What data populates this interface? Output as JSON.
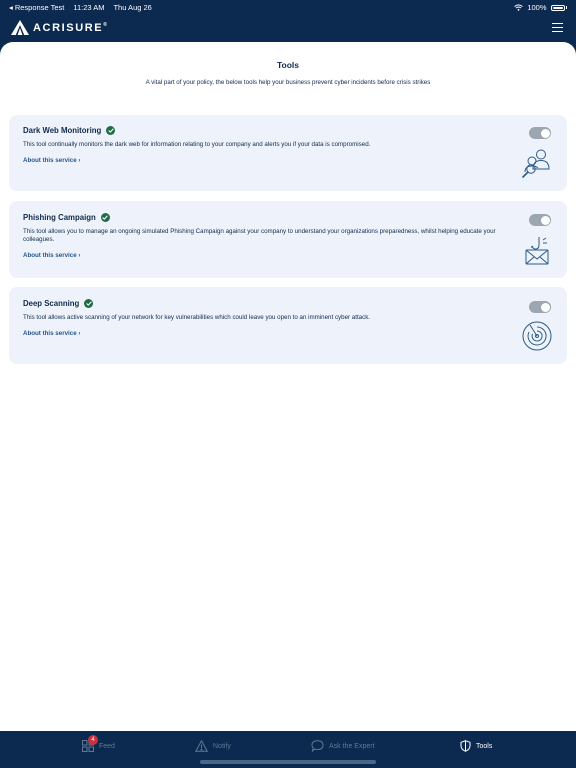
{
  "status": {
    "back_label": "◂ Response Test",
    "time": "11:23 AM",
    "date": "Thu Aug 26",
    "battery": "100%"
  },
  "header": {
    "logo_text": "ACRISURE",
    "logo_mark": "®"
  },
  "page": {
    "title": "Tools",
    "subtitle": "A vital part of your policy, the below tools help your business prevent cyber incidents before crisis strikes"
  },
  "services": [
    {
      "title": "Dark Web Monitoring",
      "description": "This tool continually monitors the dark web for information relating to your company and alerts you if your data is compromised.",
      "link": "About this service ›",
      "enabled": true,
      "icon": "users-search-icon"
    },
    {
      "title": "Phishing Campaign",
      "description": "This tool allows you to manage an ongoing simulated Phishing Campaign against your company to understand your organizations preparedness, whilst helping educate your colleagues.",
      "link": "About this service ›",
      "enabled": true,
      "icon": "phishing-envelope-icon"
    },
    {
      "title": "Deep Scanning",
      "description": "This tool allows active scanning of your network for key vulnerabilities which could leave you open to an imminent cyber attack.",
      "link": "About this service ›",
      "enabled": true,
      "icon": "radar-scan-icon"
    }
  ],
  "tabs": [
    {
      "label": "Feed",
      "icon": "grid-icon",
      "badge": "4",
      "active": false
    },
    {
      "label": "Notify",
      "icon": "warning-icon",
      "active": false
    },
    {
      "label": "Ask the Expert",
      "icon": "chat-bubble-icon",
      "active": false
    },
    {
      "label": "Tools",
      "icon": "shield-icon",
      "active": true
    }
  ],
  "colors": {
    "navy": "#0c2a4f",
    "card_bg": "#eef3fb",
    "check_green": "#1f6b46",
    "toggle_grey": "#9ca6b1",
    "badge_red": "#c8323e"
  }
}
